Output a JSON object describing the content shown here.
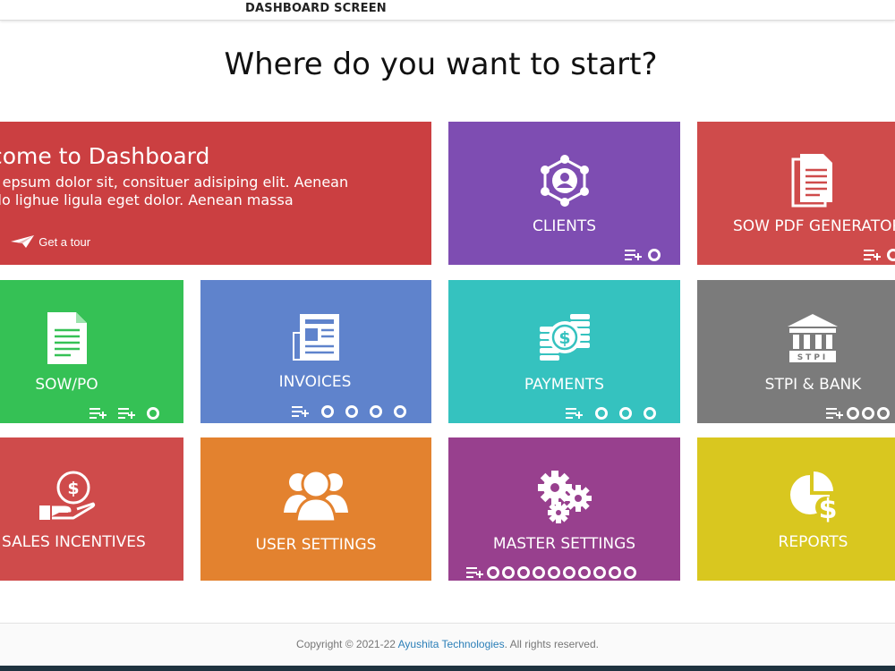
{
  "header": {
    "title": "DASHBOARD SCREEN"
  },
  "main": {
    "heading": "Where do you want to start?"
  },
  "welcome": {
    "title": "lcome to Dashboard",
    "line1": "m epsum dolor sit, consituer adisiping elit. Aenean",
    "line2": "odo lighue ligula eget dolor. Aenean massa",
    "link_left": "p",
    "tour_label": "Get a tour"
  },
  "tiles": {
    "clients": "CLIENTS",
    "sow_pdf": "SOW PDF GENERATOR",
    "sow_po": "SOW/PO",
    "invoices": "INVOICES",
    "payments": "PAYMENTS",
    "stpi": "STPI & BANK",
    "stpi_icon_text": "STPI",
    "sales": "SALES INCENTIVES",
    "user_settings": "USER SETTINGS",
    "master_settings": "MASTER SETTINGS",
    "reports": "REPORTS"
  },
  "footer": {
    "prefix": "Copyright © 2021-22 ",
    "company": "Ayushita Technologies",
    "suffix": ". All rights reserved."
  },
  "colors": {
    "welcome": "#cb3f41",
    "clients": "#7e4db2",
    "sow_pdf": "#cf4b4b",
    "sow_po": "#35c155",
    "invoices": "#5f83cc",
    "payments": "#35c2bf",
    "stpi": "#7b7b7b",
    "sales": "#cf4b4b",
    "user_settings": "#e3822f",
    "master_settings": "#98408e",
    "reports": "#d9c71f",
    "footer_link": "#2b7fb8"
  }
}
